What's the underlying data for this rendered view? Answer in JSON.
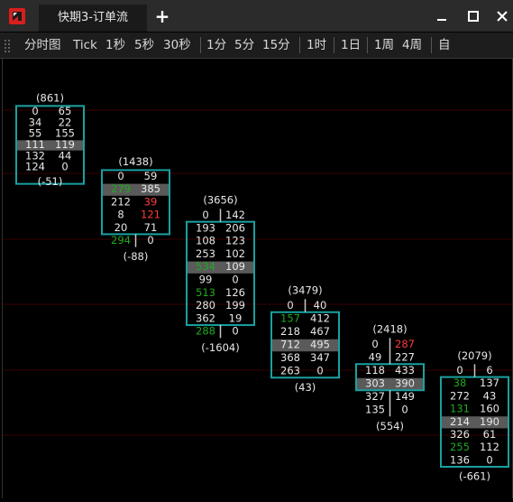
{
  "window": {
    "tab_title": "快期3-订单流",
    "add_tab": "+",
    "minimize_glyph": "─",
    "maximize_glyph": "☐",
    "close_glyph": "✕",
    "logo_icon": "app-logo-icon"
  },
  "toolbar": {
    "groups": [
      [
        "分时图",
        "Tick",
        "1秒",
        "5秒",
        "30秒"
      ],
      [
        "1分",
        "5分",
        "15分"
      ],
      [
        "1时"
      ],
      [
        "1日"
      ],
      [
        "1周",
        "4周"
      ],
      [
        "自"
      ]
    ]
  },
  "colors": {
    "background": "#000000",
    "box_border": "#1aa0a0",
    "poc_row": "#5a5a5a",
    "highlight_row": "#3c3c3c",
    "text": "#e8e8e8",
    "green": "#1faa1f",
    "red": "#ff3b3b",
    "stem": "#c8c8c8",
    "gridline": "#3a0000"
  },
  "chart_data": {
    "type": "table",
    "name": "order-flow footprint",
    "bars": [
      {
        "total": "(861)",
        "delta": "(-51)",
        "rows": [
          {
            "bid": "0",
            "ask": "65"
          },
          {
            "bid": "34",
            "ask": "22"
          },
          {
            "bid": "55",
            "ask": "155"
          },
          {
            "bid": "111",
            "ask": "119",
            "poc": true
          },
          {
            "bid": "132",
            "ask": "44"
          },
          {
            "bid": "124",
            "ask": "0"
          }
        ]
      },
      {
        "total": "(1438)",
        "delta": "(-88)",
        "rows": [
          {
            "bid": "0",
            "ask": "59"
          },
          {
            "bid": "279",
            "ask": "385",
            "bid_color": "green",
            "poc": true
          },
          {
            "bid": "212",
            "ask": "39",
            "ask_color": "red"
          },
          {
            "bid": "8",
            "ask": "121",
            "ask_color": "red"
          },
          {
            "bid": "20",
            "ask": "71"
          },
          {
            "bid": "294",
            "ask": "0",
            "bid_color": "green"
          }
        ]
      },
      {
        "total": "(3656)",
        "delta": "(-1604)",
        "rows": [
          {
            "bid": "0",
            "ask": "142"
          },
          {
            "bid": "193",
            "ask": "206"
          },
          {
            "bid": "108",
            "ask": "123"
          },
          {
            "bid": "253",
            "ask": "102"
          },
          {
            "bid": "534",
            "ask": "109",
            "bid_color": "green",
            "poc": true
          },
          {
            "bid": "99",
            "ask": "0"
          },
          {
            "bid": "513",
            "ask": "126",
            "bid_color": "green"
          },
          {
            "bid": "280",
            "ask": "199"
          },
          {
            "bid": "362",
            "ask": "19"
          },
          {
            "bid": "288",
            "ask": "0",
            "bid_color": "green"
          }
        ]
      },
      {
        "total": "(3479)",
        "delta": "(43)",
        "rows": [
          {
            "bid": "0",
            "ask": "40"
          },
          {
            "bid": "157",
            "ask": "412",
            "bid_color": "green"
          },
          {
            "bid": "218",
            "ask": "467"
          },
          {
            "bid": "712",
            "ask": "495",
            "poc": true
          },
          {
            "bid": "368",
            "ask": "347"
          },
          {
            "bid": "263",
            "ask": "0"
          }
        ]
      },
      {
        "total": "(2418)",
        "delta": "(554)",
        "rows": [
          {
            "bid": "0",
            "ask": "287",
            "ask_color": "red"
          },
          {
            "bid": "49",
            "ask": "227"
          },
          {
            "bid": "118",
            "ask": "433"
          },
          {
            "bid": "303",
            "ask": "390",
            "poc": true
          },
          {
            "bid": "327",
            "ask": "149"
          },
          {
            "bid": "135",
            "ask": "0"
          }
        ]
      },
      {
        "total": "(2079)",
        "delta": "(-661)",
        "rows": [
          {
            "bid": "0",
            "ask": "6"
          },
          {
            "bid": "38",
            "ask": "137",
            "bid_color": "green"
          },
          {
            "bid": "272",
            "ask": "43"
          },
          {
            "bid": "131",
            "ask": "160",
            "bid_color": "green"
          },
          {
            "bid": "214",
            "ask": "190",
            "poc": true
          },
          {
            "bid": "326",
            "ask": "61"
          },
          {
            "bid": "255",
            "ask": "112",
            "bid_color": "green"
          },
          {
            "bid": "136",
            "ask": "0"
          }
        ]
      }
    ]
  }
}
